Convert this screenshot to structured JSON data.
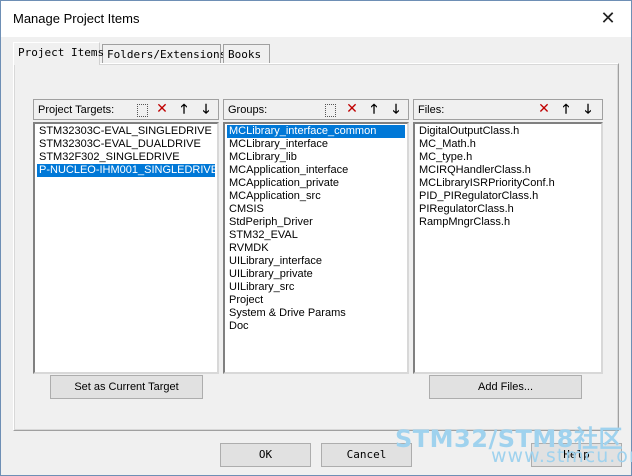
{
  "window": {
    "title": "Manage Project Items",
    "close_glyph": "✕"
  },
  "tabs": [
    {
      "label": "Project Items",
      "active": true
    },
    {
      "label": "Folders/Extensions",
      "active": false
    },
    {
      "label": "Books",
      "active": false
    }
  ],
  "targets": {
    "label": "Project Targets:",
    "items": [
      "STM32303C-EVAL_SINGLEDRIVE",
      "STM32303C-EVAL_DUALDRIVE",
      "STM32F302_SINGLEDRIVE",
      "P-NUCLEO-IHM001_SINGLEDRIVE"
    ],
    "selected_index": 3,
    "set_current_label": "Set as Current Target"
  },
  "groups": {
    "label": "Groups:",
    "items": [
      "MCLibrary_interface_common",
      "MCLibrary_interface",
      "MCLibrary_lib",
      "MCApplication_interface",
      "MCApplication_private",
      "MCApplication_src",
      "CMSIS",
      "StdPeriph_Driver",
      "STM32_EVAL",
      "RVMDK",
      "UILibrary_interface",
      "UILibrary_private",
      "UILibrary_src",
      "Project",
      "System & Drive Params",
      "Doc"
    ],
    "selected_index": 0
  },
  "files": {
    "label": "Files:",
    "items": [
      "DigitalOutputClass.h",
      "MC_Math.h",
      "MC_type.h",
      "MCIRQHandlerClass.h",
      "MCLibraryISRPriorityConf.h",
      "PID_PIRegulatorClass.h",
      "PIRegulatorClass.h",
      "RampMngrClass.h"
    ],
    "add_files_label": "Add Files..."
  },
  "toolbar_glyphs": {
    "delete": "✕",
    "up": "🡑",
    "down": "🡓"
  },
  "footer": {
    "ok_label": "OK",
    "cancel_label": "Cancel",
    "help_label": "Help"
  },
  "watermark": {
    "brand": "STM32/STM8社区",
    "url": "www.stmcu.org"
  },
  "colors": {
    "selection": "#0078d7",
    "delete_icon": "#c00000",
    "watermark": "#9fd2ee"
  }
}
